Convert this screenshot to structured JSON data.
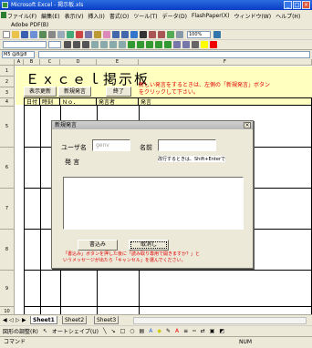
{
  "window": {
    "title": "Microsoft Excel - 掲示板.xls"
  },
  "menu": [
    "ファイル(F)",
    "編集(E)",
    "表示(V)",
    "挿入(I)",
    "書式(O)",
    "ツール(T)",
    "データ(D)",
    "FlashPaper(X)",
    "ウィンドウ(W)",
    "ヘルプ(H)"
  ],
  "addin_toolbar": {
    "label": "Adobe PDF(B)"
  },
  "standard_toolbar": {
    "zoom": "100%"
  },
  "formula_bar": {
    "name_box": "M5 @8@8"
  },
  "columns": [
    "A",
    "B",
    "C",
    "D",
    "E",
    "F"
  ],
  "rows": [
    "1",
    "2",
    "3",
    "4",
    "5",
    "6",
    "7",
    "8",
    "9",
    "10"
  ],
  "sheet": {
    "title": "Ｅｘｃｅｌ掲示板",
    "btn_refresh": "表示更新",
    "btn_new": "新規発言",
    "btn_exit": "終了",
    "instruction_line1": "新しい発言をするときは、左側の「新規発言」ボタン",
    "instruction_line2": "をクリックして下さい。",
    "table_headers": [
      "日付",
      "時刻",
      "Ｎｏ．",
      "発言者",
      "発言"
    ]
  },
  "dialog": {
    "title": "新規発言",
    "user_label": "ユーザ名",
    "user_value": "genv",
    "name_label": "名前",
    "name_value": "",
    "message_label": "発 言",
    "message_hint": "改行するときは、Shift+Enterで",
    "message_value": "",
    "submit": "書込み",
    "cancel": "取消し",
    "note_line1": "「書込み」ボタンを押した後に「読み取り専用で開きますか？」と",
    "note_line2": "いうメッセージが出たら「キャンセル」を選んでください。"
  },
  "sheet_tabs": [
    "Sheet1",
    "Sheet2",
    "Sheet3"
  ],
  "drawing_toolbar": {
    "draw": "図形の調整(R)",
    "autoshapes": "オートシェイプ(U)"
  },
  "status": {
    "left": "コマンド",
    "right": "NUM"
  }
}
